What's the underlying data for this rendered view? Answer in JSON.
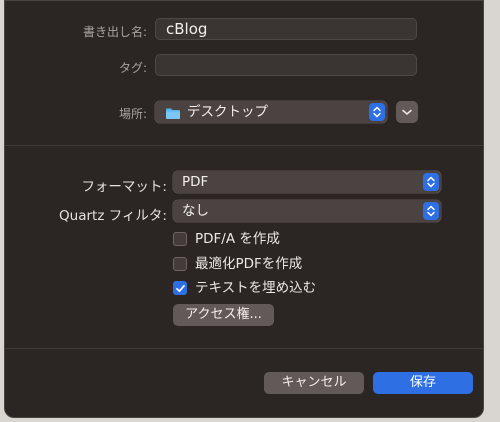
{
  "save": {
    "name_label": "書き出し名:",
    "name_value": "cBlog",
    "tags_label": "タグ:",
    "tags_value": "",
    "where_label": "場所:",
    "where_value": "デスクトップ",
    "where_icon": "folder-icon"
  },
  "options": {
    "format_label": "フォーマット:",
    "format_value": "PDF",
    "quartz_label": "Quartz フィルタ:",
    "quartz_value": "なし",
    "checkboxes": [
      {
        "label": "PDF/A を作成",
        "checked": false
      },
      {
        "label": "最適化PDFを作成",
        "checked": false
      },
      {
        "label": "テキストを埋め込む",
        "checked": true
      }
    ],
    "access_button": "アクセス権..."
  },
  "buttons": {
    "cancel": "キャンセル",
    "save": "保存"
  },
  "colors": {
    "accent": "#2f6fe4",
    "dialog_bg": "#2b2523"
  }
}
